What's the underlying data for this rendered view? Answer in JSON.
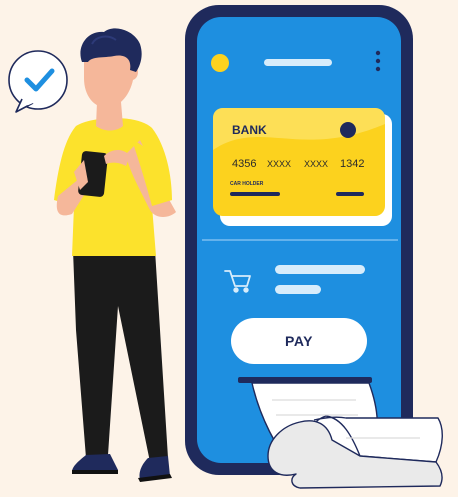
{
  "card": {
    "bank": "BANK",
    "num1": "4356",
    "num2": "XXXX",
    "num3": "XXXX",
    "num4": "1342",
    "holder": "CAR HOLDER"
  },
  "pay": {
    "label": "PAY"
  },
  "colors": {
    "background": "#fdf3e8",
    "phone_body": "#1f2a5c",
    "phone_screen": "#1e8fe0",
    "card": "#fcd21e",
    "shirt": "#fce22c",
    "check": "#1e8fe0"
  },
  "icons": [
    "checkmark-icon",
    "cart-icon",
    "menu-dots-icon"
  ]
}
